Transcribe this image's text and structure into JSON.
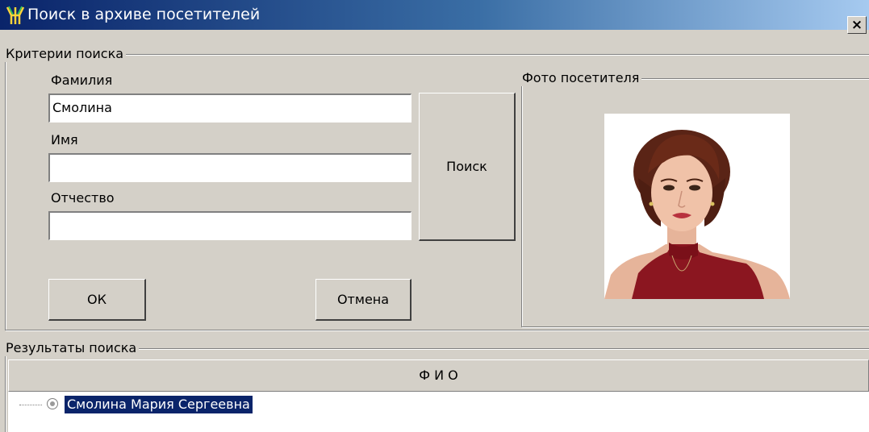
{
  "window": {
    "title": "Поиск в архиве посетителей",
    "close_glyph": "×",
    "app_icon": "visitor-app-icon"
  },
  "criteria": {
    "legend": "Критерии поиска",
    "last_name_label": "Фамилия",
    "last_name_value": "Смолина",
    "first_name_label": "Имя",
    "first_name_value": "",
    "patronymic_label": "Отчество",
    "patronymic_value": "",
    "search_button": "Поиск",
    "ok_button": "ОК",
    "cancel_button": "Отмена"
  },
  "photo": {
    "legend": "Фото посетителя"
  },
  "results": {
    "legend": "Результаты поиска",
    "column_header": "Ф И О",
    "rows": [
      {
        "name": "Смолина Мария Сергеевна",
        "selected": true
      }
    ]
  },
  "colors": {
    "window_bg": "#d4d0c8",
    "title_gradient_start": "#0a246a",
    "title_gradient_end": "#a6caf0",
    "selection_bg": "#0a246a"
  }
}
